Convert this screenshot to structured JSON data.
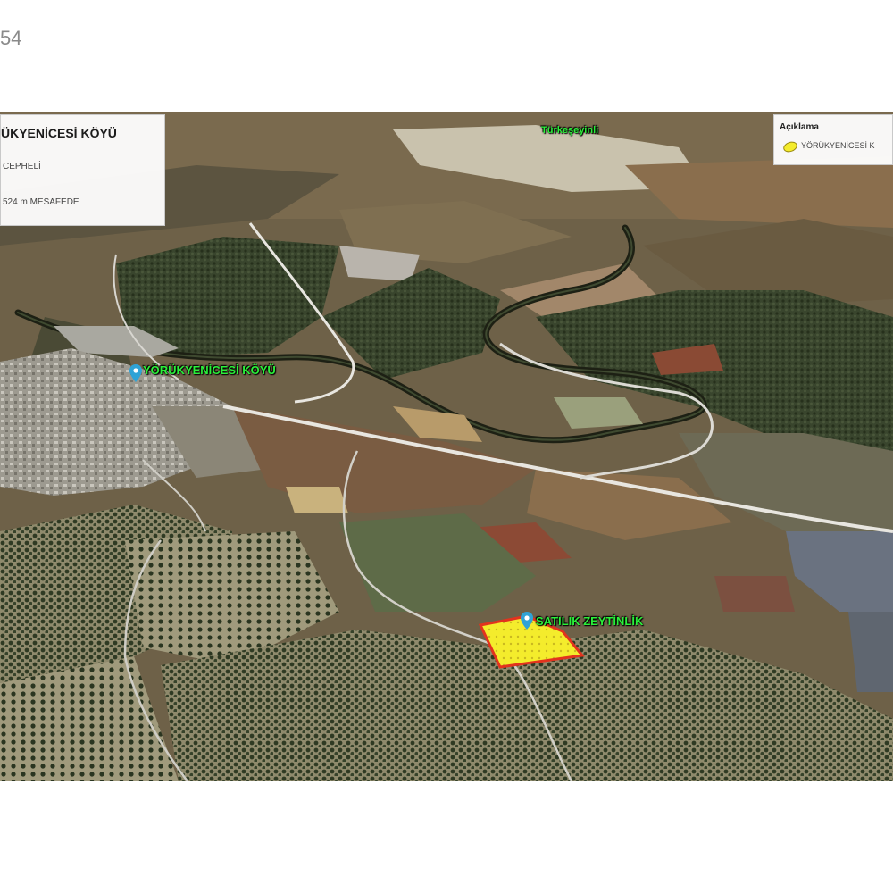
{
  "page": {
    "number_fragment": "54"
  },
  "info_panel": {
    "title": "ÜKYENİCESİ KÖYÜ",
    "line1": "CEPHELİ",
    "line2": "524 m MESAFEDE"
  },
  "legend": {
    "header": "Açıklama",
    "item_label": "YÖRÜKYENİCESİ K",
    "item_color": "#f4ec2c"
  },
  "map_labels": {
    "top_town": "Türkeşeyinli",
    "village": "YÖRÜKYENİCESİ KÖYÜ",
    "parcel": "SATILIK ZEYTİNLİK"
  },
  "colors": {
    "label_green": "#2bf03a",
    "parcel_fill": "#f4ec2c",
    "parcel_border": "#e2331e",
    "pin": "#2fa3d6"
  },
  "icons": {
    "pin": "map-pin-icon",
    "legend": "polygon-swatch-icon"
  }
}
